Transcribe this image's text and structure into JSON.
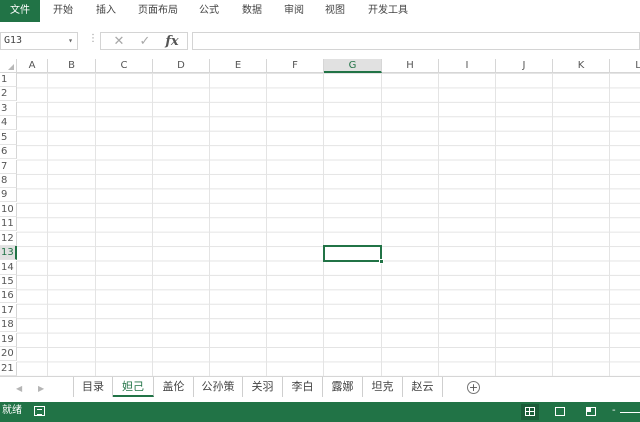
{
  "ribbon": {
    "tabs": [
      "文件",
      "开始",
      "插入",
      "页面布局",
      "公式",
      "数据",
      "审阅",
      "视图",
      "开发工具"
    ]
  },
  "formula_bar": {
    "name_box": "G13",
    "dots": "⋮",
    "cancel_icon": "✕",
    "enter_icon": "✓",
    "fx": "fx",
    "formula_value": ""
  },
  "grid": {
    "columns": [
      "A",
      "B",
      "C",
      "D",
      "E",
      "F",
      "G",
      "H",
      "I",
      "J",
      "K",
      "L"
    ],
    "rows": [
      "1",
      "2",
      "3",
      "4",
      "5",
      "6",
      "7",
      "8",
      "9",
      "10",
      "11",
      "12",
      "13",
      "14",
      "15",
      "16",
      "17",
      "18",
      "19",
      "20",
      "21"
    ],
    "selected_column": "G",
    "selected_row": "13",
    "selected_cell": "G13"
  },
  "sheets": {
    "tabs": [
      "目录",
      "妲己",
      "盖伦",
      "公孙策",
      "关羽",
      "李白",
      "露娜",
      "坦克",
      "赵云"
    ],
    "active": "妲己",
    "nav_prev": "◀",
    "nav_next": "▶",
    "add_label": "+"
  },
  "status": {
    "text": "就绪",
    "zoom_minus": "-"
  },
  "colors": {
    "accent": "#217346"
  }
}
